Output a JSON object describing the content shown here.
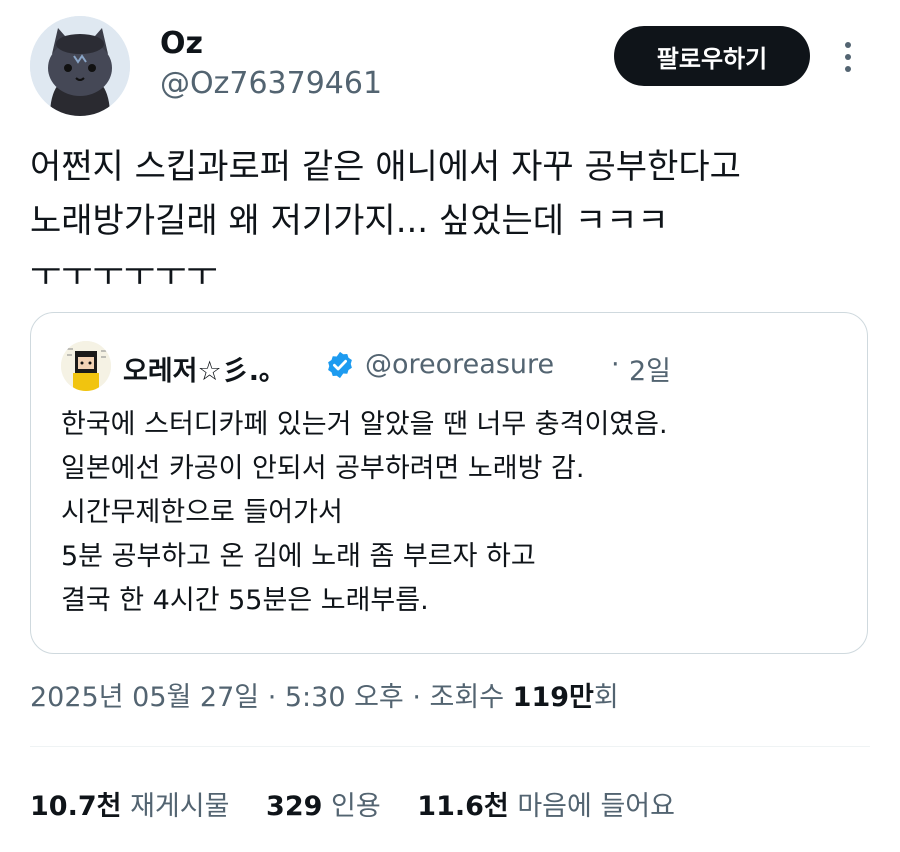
{
  "author": {
    "name": "Oz",
    "handle": "@Oz76379461",
    "follow_label": "팔로우하기"
  },
  "tweet": {
    "text": "어쩐지 스킵과로퍼 같은 애니에서 자꾸 공부한다고\n노래방가길래 왜 저기가지... 싶었는데 ㅋㅋㅋ\nㅜㅜㅜㅜㅜㅜ"
  },
  "quoted": {
    "name": "오레저☆彡.｡",
    "handle": "@oreoreasure",
    "separator": "·",
    "time": "2일",
    "text": "한국에 스터디카페 있는거 알았을 땐 너무 충격이였음.\n일본에선 카공이 안되서 공부하려면 노래방 감.\n시간무제한으로 들어가서\n5분 공부하고 온 김에 노래 좀 부르자 하고\n결국 한 4시간 55분은 노래부름."
  },
  "meta": {
    "date": "2025년 05월 27일",
    "time": "5:30 오후",
    "views_label": "조회수",
    "views_count": "119만",
    "views_suffix": "회",
    "sep": " · "
  },
  "stats": {
    "retweets_count": "10.7천",
    "retweets_label": "재게시물",
    "quotes_count": "329",
    "quotes_label": "인용",
    "likes_count": "11.6천",
    "likes_label": "마음에 들어요"
  },
  "colors": {
    "text_primary": "#0f1419",
    "text_secondary": "#536471",
    "verified": "#1d9bf0",
    "border": "#cfd9de"
  },
  "icons": {
    "more": "more-vertical-icon",
    "verified": "verified-badge-icon"
  }
}
